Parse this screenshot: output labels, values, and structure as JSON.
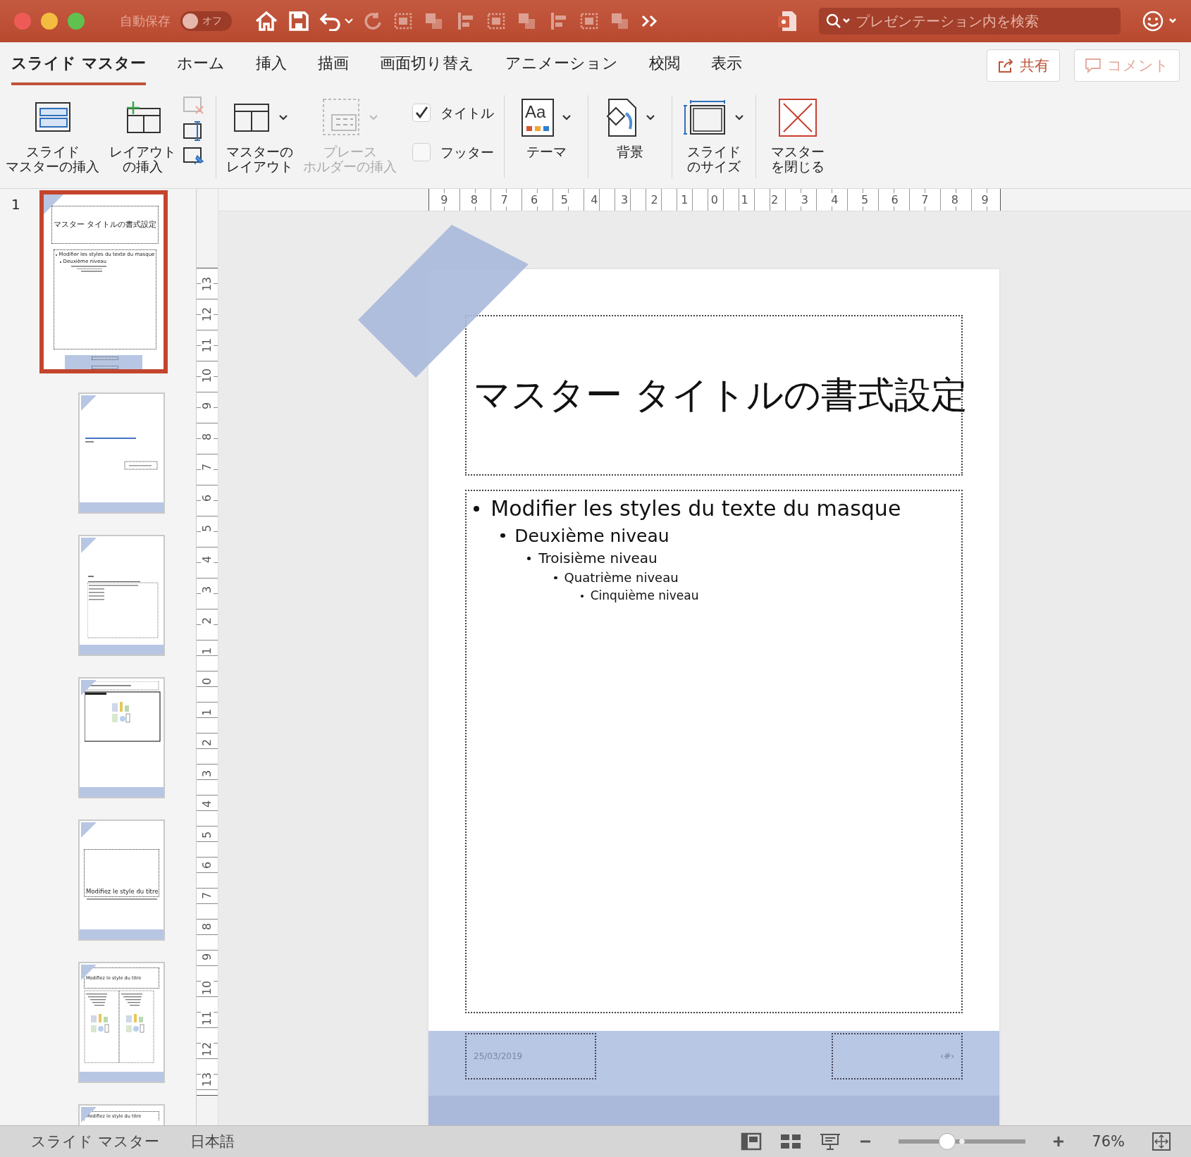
{
  "window": {
    "autosave_label": "自動保存",
    "autosave_toggle": {
      "label": "オフ",
      "on": false
    },
    "search": {
      "placeholder": "プレゼンテーション内を検索"
    }
  },
  "tabs": [
    {
      "label": "スライド マスター",
      "selected": true
    },
    {
      "label": "ホーム",
      "selected": false
    },
    {
      "label": "挿入",
      "selected": false
    },
    {
      "label": "描画",
      "selected": false
    },
    {
      "label": "画面切り替え",
      "selected": false
    },
    {
      "label": "アニメーション",
      "selected": false
    },
    {
      "label": "校閲",
      "selected": false
    },
    {
      "label": "表示",
      "selected": false
    }
  ],
  "share_button": {
    "label": "共有"
  },
  "comment_button": {
    "label": "コメント",
    "disabled": true
  },
  "ribbon": [
    {
      "items": [
        {
          "kind": "large",
          "label": [
            "スライド",
            "マスターの挿入"
          ],
          "disabled": false
        },
        {
          "kind": "large",
          "label": [
            "レイアウト",
            "の挿入"
          ],
          "disabled": false
        },
        {
          "kind": "stack"
        }
      ]
    },
    {
      "items": [
        {
          "kind": "dropdown",
          "label": [
            "マスターの",
            "レイアウト"
          ],
          "disabled": false
        },
        {
          "kind": "dropdown",
          "label": [
            "プレース",
            "ホルダーの挿入"
          ],
          "disabled": true
        },
        {
          "kind": "checks",
          "checks": [
            {
              "label": "タイトル",
              "checked": true
            },
            {
              "label": "フッター",
              "checked": false
            }
          ]
        }
      ]
    },
    {
      "items": [
        {
          "kind": "dropdown",
          "label": [
            "テーマ"
          ],
          "icon_text": "Aa",
          "disabled": false
        }
      ]
    },
    {
      "items": [
        {
          "kind": "dropdown",
          "label": [
            "背景"
          ],
          "disabled": false
        }
      ]
    },
    {
      "items": [
        {
          "kind": "dropdown",
          "label": [
            "スライド",
            "のサイズ"
          ],
          "disabled": false
        }
      ]
    },
    {
      "items": [
        {
          "kind": "large",
          "label": [
            "マスター",
            "を閉じる"
          ],
          "disabled": false
        }
      ]
    }
  ],
  "thumbnails": [
    {
      "number": "1",
      "kind": "master",
      "selected": true,
      "title": "マスター タイトルの書式設定",
      "bullets": [
        "Modifier les styles du texte du masque",
        "Deuxième niveau"
      ]
    },
    {
      "kind": "title",
      "selected": false
    },
    {
      "kind": "toc",
      "selected": false
    },
    {
      "kind": "chart",
      "selected": false
    },
    {
      "kind": "section",
      "selected": false,
      "title": "Modifiez le style du titre"
    },
    {
      "kind": "two",
      "selected": false,
      "title": "Modifiez le style du titre"
    },
    {
      "kind": "partial",
      "selected": false,
      "title": "Modifiez le style du titre"
    }
  ],
  "ruler": {
    "horizontal": [
      "9",
      "8",
      "7",
      "6",
      "5",
      "4",
      "3",
      "2",
      "1",
      "0",
      "1",
      "2",
      "3",
      "4",
      "5",
      "6",
      "7",
      "8",
      "9"
    ],
    "vertical": [
      "13",
      "12",
      "11",
      "10",
      "9",
      "8",
      "7",
      "6",
      "5",
      "4",
      "3",
      "2",
      "1",
      "0",
      "1",
      "2",
      "3",
      "4",
      "5",
      "6",
      "7",
      "8",
      "9",
      "10",
      "11",
      "12",
      "13"
    ]
  },
  "slide": {
    "title": "マスター タイトルの書式設定",
    "bullets": [
      {
        "text": "Modifier les styles du texte du masque",
        "children": [
          {
            "text": "Deuxième niveau",
            "children": [
              {
                "text": "Troisième niveau",
                "children": [
                  {
                    "text": "Quatrième niveau",
                    "children": [
                      {
                        "text": "Cinquième niveau"
                      }
                    ]
                  }
                ]
              }
            ]
          }
        ]
      }
    ],
    "date": "25/03/2019",
    "page_number": "‹#›"
  },
  "status_bar": {
    "view_label": "スライド マスター",
    "language": "日本語",
    "zoom": {
      "level": 0.38,
      "reading": "76%"
    }
  }
}
